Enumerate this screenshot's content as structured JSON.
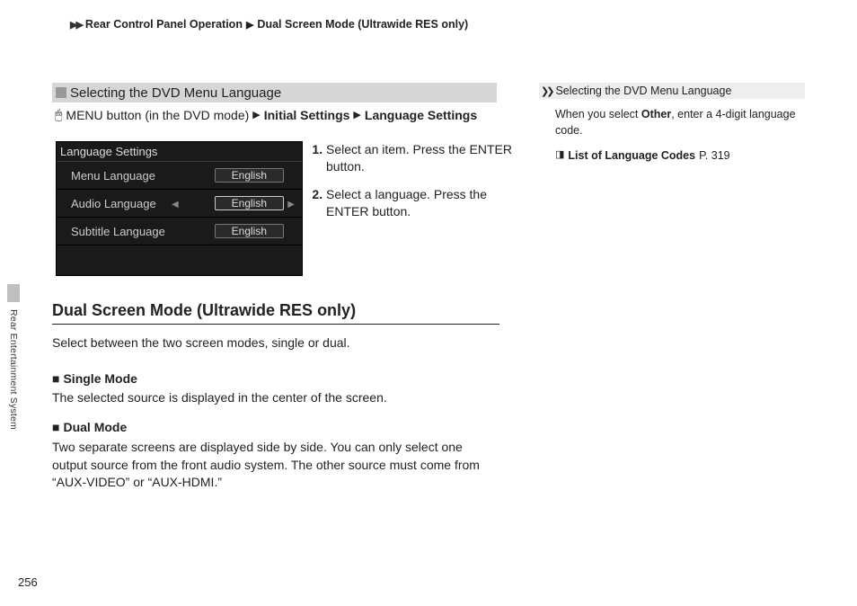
{
  "breadcrumb": {
    "item1": "Rear Control Panel Operation",
    "item2": "Dual Screen Mode (Ultrawide RES only)"
  },
  "section_title": "Selecting the DVD Menu Language",
  "menu_path": {
    "part1": "MENU button (in the DVD mode)",
    "part2": "Initial Settings",
    "part3": "Language Settings"
  },
  "screenshot": {
    "header": "Language Settings",
    "rows": [
      {
        "label": "Menu Language",
        "value": "English",
        "selected": false
      },
      {
        "label": "Audio Language",
        "value": "English",
        "selected": true
      },
      {
        "label": "Subtitle Language",
        "value": "English",
        "selected": false
      }
    ]
  },
  "steps": {
    "s1": "Select an item. Press the ENTER button.",
    "s2": "Select a language. Press the ENTER button."
  },
  "main_heading": "Dual Screen Mode (Ultrawide RES only)",
  "main_desc": "Select between the two screen modes, single or dual.",
  "sub1": {
    "title": "Single Mode",
    "text": "The selected source is displayed in the center of the screen."
  },
  "sub2": {
    "title": "Dual Mode",
    "text": "Two separate screens are displayed side by side. You can only select one output source from the front audio system. The other source must come from “AUX-VIDEO” or “AUX-HDMI.”"
  },
  "right": {
    "head": "Selecting the DVD Menu Language",
    "body_pre": "When you select ",
    "body_bold": "Other",
    "body_post": ", enter a 4-digit language code.",
    "link_label": "List of Language Codes",
    "link_page": "P. 319"
  },
  "side_label": "Rear Entertainment System",
  "page_number": "256"
}
